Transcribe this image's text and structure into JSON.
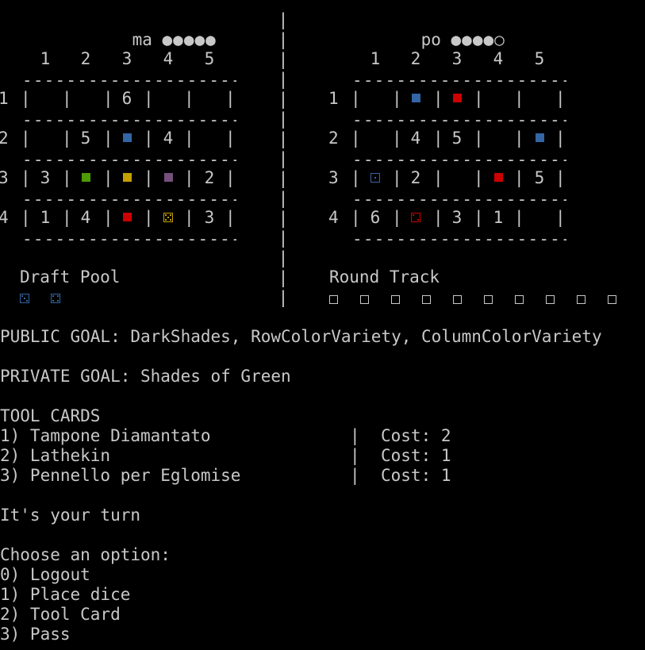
{
  "colors": {
    "blue": "#3465a4",
    "red": "#cc0000",
    "green": "#4e9a06",
    "yellow": "#c4a000",
    "purple": "#75507b",
    "text": "#c8c8c8"
  },
  "player1": {
    "name": "ma",
    "tokens": "●●●●●",
    "cols": [
      "1",
      "2",
      "3",
      "4",
      "5"
    ],
    "rows": [
      {
        "label": "1",
        "cells": [
          {
            "t": ""
          },
          {
            "t": ""
          },
          {
            "t": "6"
          },
          {
            "t": ""
          },
          {
            "t": ""
          }
        ]
      },
      {
        "label": "2",
        "cells": [
          {
            "t": ""
          },
          {
            "t": "5"
          },
          {
            "sq": "blue"
          },
          {
            "t": "4"
          },
          {
            "t": ""
          }
        ]
      },
      {
        "label": "3",
        "cells": [
          {
            "t": "3"
          },
          {
            "sq": "green"
          },
          {
            "sq": "yellow"
          },
          {
            "sq": "purple"
          },
          {
            "t": "2"
          }
        ]
      },
      {
        "label": "4",
        "cells": [
          {
            "t": "1"
          },
          {
            "t": "4"
          },
          {
            "sq": "red"
          },
          {
            "die": "yellow",
            "v": 5
          },
          {
            "t": "3"
          }
        ]
      }
    ]
  },
  "player2": {
    "name": "po",
    "tokens": "●●●●○",
    "cols": [
      "1",
      "2",
      "3",
      "4",
      "5"
    ],
    "rows": [
      {
        "label": "1",
        "cells": [
          {
            "t": ""
          },
          {
            "sq": "blue"
          },
          {
            "sq": "red"
          },
          {
            "t": ""
          },
          {
            "t": ""
          }
        ]
      },
      {
        "label": "2",
        "cells": [
          {
            "t": ""
          },
          {
            "t": "4"
          },
          {
            "t": "5"
          },
          {
            "t": ""
          },
          {
            "sq": "blue"
          }
        ]
      },
      {
        "label": "3",
        "cells": [
          {
            "die": "blue",
            "v": 1
          },
          {
            "t": "2"
          },
          {
            "t": ""
          },
          {
            "sq": "red"
          },
          {
            "t": "5"
          }
        ]
      },
      {
        "label": "4",
        "cells": [
          {
            "t": "6"
          },
          {
            "die": "red",
            "v": 2
          },
          {
            "t": "3"
          },
          {
            "t": "1"
          },
          {
            "t": ""
          }
        ]
      }
    ]
  },
  "draft_pool": {
    "label": "Draft Pool",
    "dice": [
      {
        "color": "blue",
        "v": 3
      },
      {
        "color": "blue",
        "v": 4
      }
    ]
  },
  "round_track": {
    "label": "Round Track",
    "slots": 10
  },
  "public_goal": "PUBLIC GOAL: DarkShades, RowColorVariety, ColumnColorVariety",
  "private_goal": "PRIVATE GOAL: Shades of Green",
  "tool_cards": {
    "header": "TOOL CARDS",
    "items": [
      {
        "name": "1) Tampone Diamantato",
        "cost": "Cost: 2"
      },
      {
        "name": "2) Lathekin",
        "cost": "Cost: 1"
      },
      {
        "name": "3) Pennello per Eglomise",
        "cost": "Cost: 1"
      }
    ]
  },
  "turn_msg": "It's your turn",
  "menu": {
    "prompt": "Choose an option:",
    "options": [
      "0) Logout",
      "1) Place dice",
      "2) Tool Card",
      "3) Pass"
    ]
  }
}
